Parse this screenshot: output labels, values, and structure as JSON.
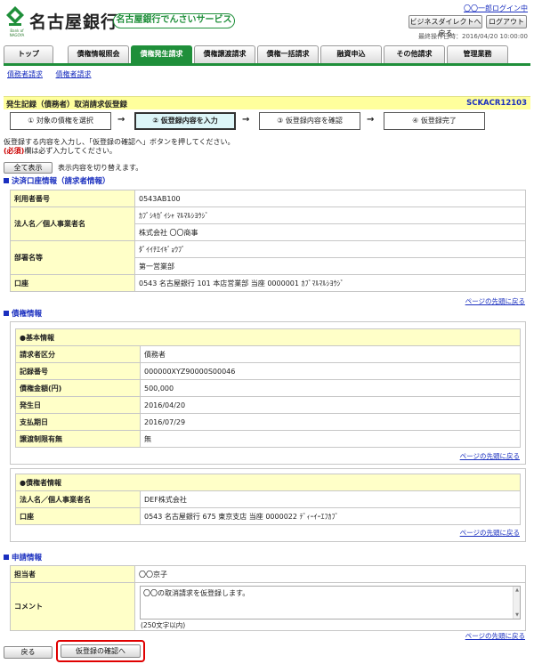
{
  "header": {
    "logo_sub": "Bank of NAGOYA",
    "bank_name": "名古屋銀行",
    "service_name": "名古屋銀行でんさいサービス",
    "user_login": "〇〇一郎ログイン中",
    "btn_business_direct": "ビジネスダイレクトへ戻る",
    "btn_logout": "ログアウト",
    "last_operation": "最終操作日時：2016/04/20 10:00:00",
    "brand_color": "#1f8f3a"
  },
  "nav": {
    "tabs": [
      "トップ",
      "債権情報照会",
      "債権発生請求",
      "債権譲渡請求",
      "債権一括請求",
      "融資申込",
      "その他請求",
      "管理業務"
    ],
    "active_index": 2,
    "subnav": [
      "債務者請求",
      "債権者請求"
    ]
  },
  "page": {
    "title": "発生記録（債務者）取消請求仮登録",
    "code": "SCKACR12103",
    "steps": [
      "① 対象の債権を選択",
      "② 仮登録内容を入力",
      "③ 仮登録内容を確認",
      "④ 仮登録完了"
    ],
    "active_step": 1,
    "instruction_line1": "仮登録する内容を入力し、「仮登録の確認へ」ボタンを押してください。",
    "required_mark": "(必須)",
    "instruction_line2": "欄は必ず入力してください。",
    "btn_show_all": "全て表示",
    "show_all_note": "表示内容を切り替えます。",
    "page_top_link": "ページの先頭に戻る"
  },
  "settlement": {
    "heading": "決済口座情報（請求者情報）",
    "user_no_label": "利用者番号",
    "user_no": "0543AB100",
    "name_label": "法人名／個人事業者名",
    "name_kana": "ｶﾌﾞｼｷｶﾞｲｼｬ ﾏﾙﾏﾙｼﾖｳｼﾞ",
    "name": "株式会社 〇〇商事",
    "dept_label": "部署名等",
    "dept_kana": "ﾀﾞｲｲﾁｴｲｷﾞｮｳﾌﾞ",
    "dept": "第一営業部",
    "account_label": "口座",
    "account": "0543 名古屋銀行 101 本店営業部 当座 0000001 ｶﾌﾞﾏﾙﾏﾙｼﾖｳｼﾞ"
  },
  "claim": {
    "heading": "債権情報",
    "basic_heading": "●基本情報",
    "rows": [
      {
        "label": "請求者区分",
        "value": "債務者"
      },
      {
        "label": "記録番号",
        "value": "000000XYZ90000S00046"
      },
      {
        "label": "債権金額(円)",
        "value": "500,000"
      },
      {
        "label": "発生日",
        "value": "2016/04/20"
      },
      {
        "label": "支払期日",
        "value": "2016/07/29"
      },
      {
        "label": "譲渡制限有無",
        "value": "無"
      }
    ],
    "creditor_heading": "●債権者情報",
    "creditor_rows": [
      {
        "label": "法人名／個人事業者名",
        "value": "DEF株式会社"
      },
      {
        "label": "口座",
        "value": "0543 名古屋銀行 675 東京支店 当座 0000022 ﾃﾞｨｰｲｰｴﾌｶﾌﾞ"
      }
    ]
  },
  "application": {
    "heading": "申請情報",
    "person_label": "担当者",
    "person": "〇〇京子",
    "comment_label": "コメント",
    "comment": "〇〇の取消請求を仮登録します。",
    "comment_hint": "(250文字以内)"
  },
  "footer": {
    "btn_back": "戻る",
    "btn_confirm": "仮登録の確認へ",
    "highlight_color": "#e00000"
  }
}
